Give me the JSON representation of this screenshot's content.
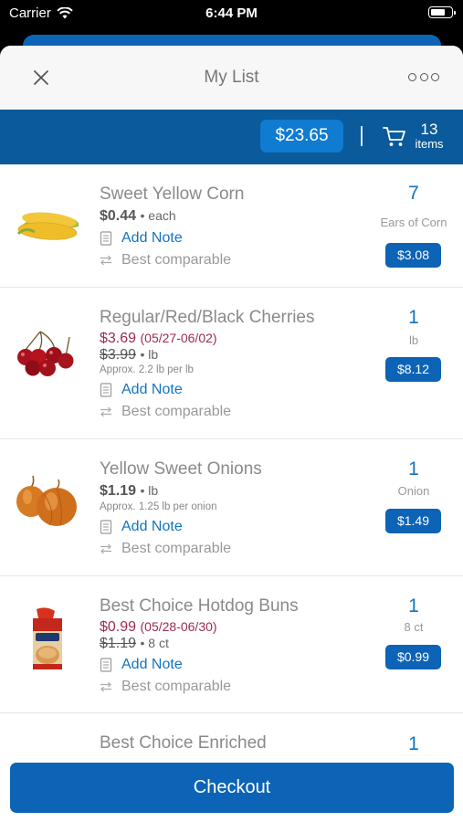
{
  "status_bar": {
    "carrier": "Carrier",
    "time": "6:44 PM"
  },
  "header": {
    "title": "My List"
  },
  "summary": {
    "total": "$23.65",
    "items_count": "13",
    "items_label": "items"
  },
  "items": [
    {
      "name": "Sweet Yellow Corn",
      "price": "$0.44",
      "price_unit": "• each",
      "add_note": "Add Note",
      "comparable": "Best comparable",
      "qty": "7",
      "unit": "Ears of Corn",
      "line_total": "$3.08"
    },
    {
      "name": "Regular/Red/Black Cherries",
      "sale_price": "$3.69",
      "sale_dates": "(05/27-06/02)",
      "orig_price": "$3.99",
      "orig_unit": "• lb",
      "approx": "Approx. 2.2 lb per lb",
      "add_note": "Add Note",
      "comparable": "Best comparable",
      "qty": "1",
      "unit": "lb",
      "line_total": "$8.12"
    },
    {
      "name": "Yellow Sweet Onions",
      "price": "$1.19",
      "price_unit": "• lb",
      "approx": "Approx. 1.25 lb per onion",
      "add_note": "Add Note",
      "comparable": "Best comparable",
      "qty": "1",
      "unit": "Onion",
      "line_total": "$1.49"
    },
    {
      "name": "Best Choice Hotdog Buns",
      "sale_price": "$0.99",
      "sale_dates": "(05/28-06/30)",
      "orig_price": "$1.19",
      "orig_unit": "• 8 ct",
      "add_note": "Add Note",
      "comparable": "Best comparable",
      "qty": "1",
      "unit": "8 ct",
      "line_total": "$0.99"
    },
    {
      "name": "Best Choice Enriched",
      "qty": "1"
    }
  ],
  "checkout": {
    "label": "Checkout"
  },
  "icons": {
    "status": [
      "wifi-icon",
      "battery-icon"
    ],
    "header": [
      "close-icon",
      "more-icon"
    ],
    "summary": [
      "cart-icon"
    ],
    "rows": [
      "note-icon",
      "compare-icon"
    ]
  },
  "colors": {
    "brand_blue": "#0d63b5",
    "summary_bar": "#0a5a9c",
    "pill_blue": "#0f7bd1",
    "sale_red": "#9b2a55",
    "link_blue": "#1473c0"
  }
}
